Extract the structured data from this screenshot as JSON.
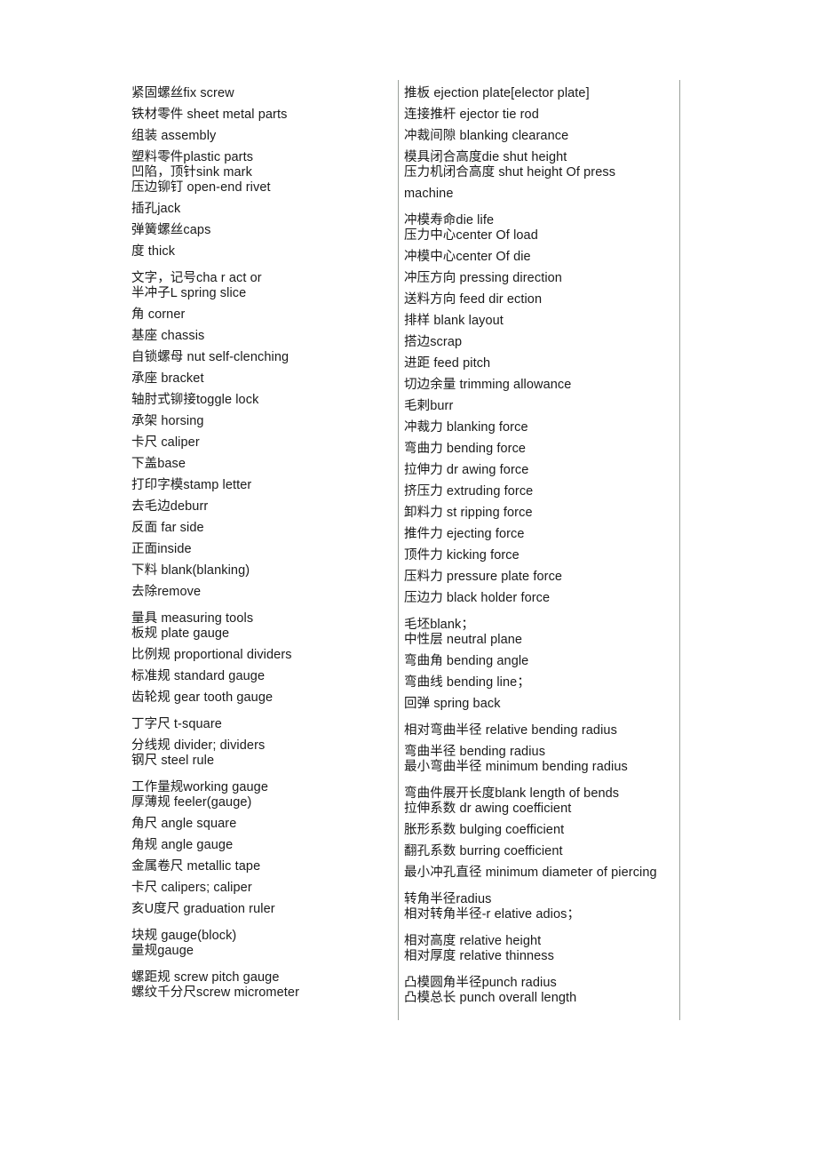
{
  "document": {
    "type": "glossary",
    "description": "Chinese-English stamping die and measuring tool terminology glossary, two columns",
    "columns": [
      {
        "name": "left-column",
        "entries": [
          {
            "text": "紧固螺丝fix screw",
            "gap": "lg"
          },
          {
            "text": "铁材零件 sheet metal parts",
            "gap": "lg"
          },
          {
            "text": "组装 assembly",
            "gap": "lg"
          },
          {
            "text": "塑料零件plastic parts",
            "gap": "lg"
          },
          {
            "text": "凹陷，顶针sink mark",
            "gap": "sm"
          },
          {
            "text": "压边铆钉 open-end rivet",
            "gap": "sm"
          },
          {
            "text": "插孔jack",
            "gap": "lg"
          },
          {
            "text": "弹簧螺丝caps",
            "gap": "lg"
          },
          {
            "text": "度 thick",
            "gap": "lg"
          },
          {
            "text": "文字，记号cha r act or",
            "gap": "xl"
          },
          {
            "text": "半冲子L spring slice",
            "gap": "sm"
          },
          {
            "text": "角 corner",
            "gap": "lg"
          },
          {
            "text": "基座 chassis",
            "gap": "lg"
          },
          {
            "text": "自锁螺母 nut self-clenching",
            "gap": "lg"
          },
          {
            "text": "承座 bracket",
            "gap": "lg"
          },
          {
            "text": "轴肘式铆接toggle lock",
            "gap": "lg"
          },
          {
            "text": "承架 horsing",
            "gap": "lg"
          },
          {
            "text": "卡尺 caliper",
            "gap": "lg"
          },
          {
            "text": "下盖base",
            "gap": "lg"
          },
          {
            "text": "打印字模stamp letter",
            "gap": "lg"
          },
          {
            "text": "去毛边deburr",
            "gap": "lg"
          },
          {
            "text": "反面 far side",
            "gap": "lg"
          },
          {
            "text": "正面inside",
            "gap": "lg"
          },
          {
            "text": "下料 blank(blanking)",
            "gap": "lg"
          },
          {
            "text": "去除remove",
            "gap": "lg"
          },
          {
            "text": "量具 measuring tools",
            "gap": "xl"
          },
          {
            "text": "板规 plate gauge",
            "gap": "sm"
          },
          {
            "text": "比例规 proportional dividers",
            "gap": "lg"
          },
          {
            "text": "标准规 standard gauge",
            "gap": "lg"
          },
          {
            "text": "齿轮规 gear tooth gauge",
            "gap": "lg"
          },
          {
            "text": "丁字尺 t-square",
            "gap": "xl"
          },
          {
            "text": "分线规 divider; dividers",
            "gap": "lg"
          },
          {
            "text": "钢尺 steel rule",
            "gap": "sm"
          },
          {
            "text": "工作量规working gauge",
            "gap": "xl"
          },
          {
            "text": "厚薄规 feeler(gauge)",
            "gap": "sm"
          },
          {
            "text": "角尺 angle square",
            "gap": "lg"
          },
          {
            "text": "角规 angle gauge",
            "gap": "lg"
          },
          {
            "text": "金属卷尺 metallic tape",
            "gap": "lg"
          },
          {
            "text": "卡尺 calipers; caliper",
            "gap": "lg"
          },
          {
            "text": "亥U度尺 graduation ruler",
            "gap": "lg"
          },
          {
            "text": "块规 gauge(block)",
            "gap": "xl"
          },
          {
            "text": "量规gauge",
            "gap": "sm"
          },
          {
            "text": "螺距规 screw pitch gauge",
            "gap": "xl"
          },
          {
            "text": "螺纹千分尺screw micrometer",
            "gap": "sm"
          }
        ]
      },
      {
        "name": "right-column",
        "entries": [
          {
            "text": "推板 ejection plate[elector plate]",
            "gap": "lg"
          },
          {
            "text": "连接推杆 ejector tie rod",
            "gap": "lg"
          },
          {
            "text": "冲裁间隙 blanking clearance",
            "gap": "lg"
          },
          {
            "text": "模具闭合高度die shut height",
            "gap": "lg"
          },
          {
            "text": "压力机闭合高度 shut height Of press",
            "gap": "sm"
          },
          {
            "text": "machine",
            "gap": "lg"
          },
          {
            "text": "冲模寿命die life",
            "gap": "xl"
          },
          {
            "text": "压力中心center Of load",
            "gap": "sm"
          },
          {
            "text": "冲模中心center Of die",
            "gap": "lg"
          },
          {
            "text": "冲压方向 pressing direction",
            "gap": "lg"
          },
          {
            "text": "送料方向 feed dir ection",
            "gap": "lg"
          },
          {
            "text": "排样 blank layout",
            "gap": "lg"
          },
          {
            "text": "搭边scrap",
            "gap": "lg"
          },
          {
            "text": "进距 feed pitch",
            "gap": "lg"
          },
          {
            "text": "切边余量 trimming allowance",
            "gap": "lg"
          },
          {
            "text": "毛剌burr",
            "gap": "lg"
          },
          {
            "text": "冲裁力 blanking force",
            "gap": "lg"
          },
          {
            "text": "弯曲力 bending force",
            "gap": "lg"
          },
          {
            "text": "拉伸力 dr awing force",
            "gap": "lg"
          },
          {
            "text": "挤压力 extruding force",
            "gap": "lg"
          },
          {
            "text": "卸料力 st ripping force",
            "gap": "lg"
          },
          {
            "text": "推件力 ejecting force",
            "gap": "lg"
          },
          {
            "text": "顶件力 kicking force",
            "gap": "lg"
          },
          {
            "text": "压料力 pressure plate force",
            "gap": "lg"
          },
          {
            "text": "压边力 black holder force",
            "gap": "lg"
          },
          {
            "text": "毛坯blank；",
            "gap": "xl"
          },
          {
            "text": "中性层 neutral plane",
            "gap": "sm"
          },
          {
            "text": "弯曲角 bending angle",
            "gap": "lg"
          },
          {
            "text": "弯曲线 bending line；",
            "gap": "lg"
          },
          {
            "text": "回弹 spring back",
            "gap": "lg"
          },
          {
            "text": "相对弯曲半径 relative bending radius",
            "gap": "xl"
          },
          {
            "text": "弯曲半径 bending radius",
            "gap": "lg"
          },
          {
            "text": "最小弯曲半径 minimum bending radius",
            "gap": "sm"
          },
          {
            "text": "弯曲件展开长度blank length of bends",
            "gap": "xl"
          },
          {
            "text": "拉伸系数 dr awing coefficient",
            "gap": "sm"
          },
          {
            "text": "胀形系数 bulging coefficient",
            "gap": "lg"
          },
          {
            "text": "翻孔系数 burring coefficient",
            "gap": "lg"
          },
          {
            "text": "最小冲孔直径 minimum diameter of piercing",
            "gap": "lg"
          },
          {
            "text": "转角半径radius",
            "gap": "xl"
          },
          {
            "text": "相对转角半径-r elative adios；",
            "gap": "sm"
          },
          {
            "text": "相对高度 relative height",
            "gap": "xl"
          },
          {
            "text": "相对厚度 relative thinness",
            "gap": "sm"
          },
          {
            "text": "凸模圆角半径punch radius",
            "gap": "xl"
          },
          {
            "text": "凸模总长 punch overall length",
            "gap": "sm"
          }
        ]
      }
    ]
  }
}
